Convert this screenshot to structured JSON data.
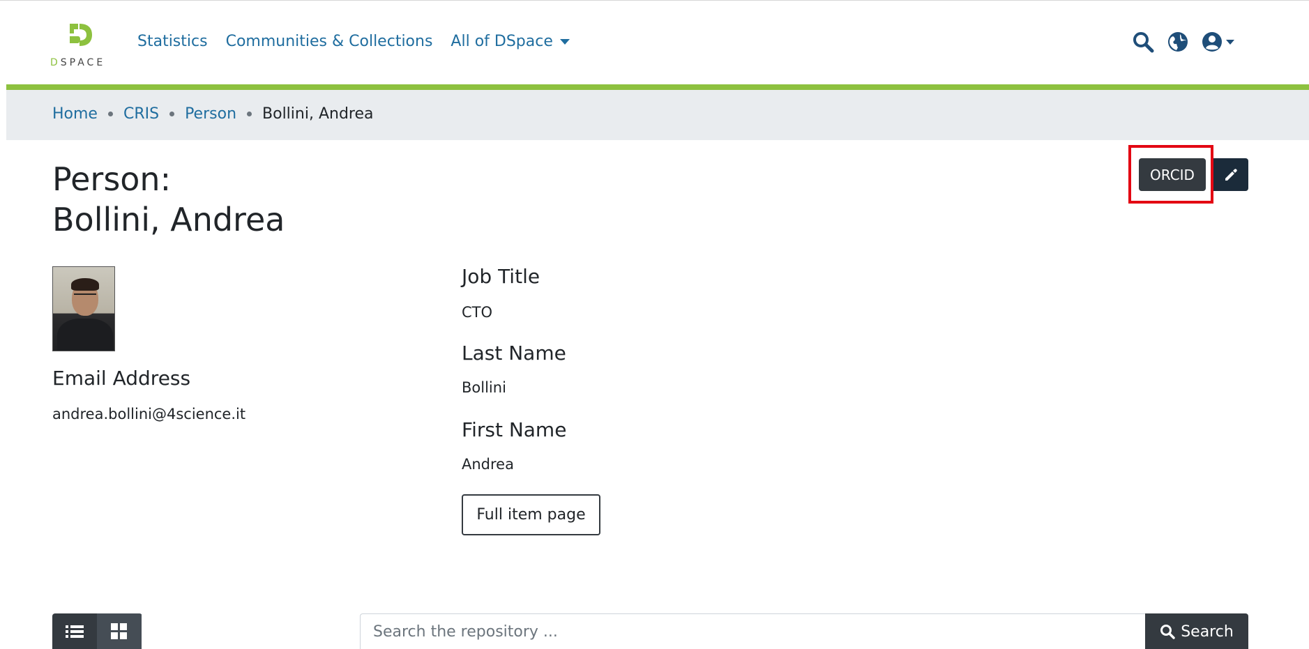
{
  "brand": {
    "logo_text": "DSPACE",
    "accent_color": "#8dc13f",
    "link_color": "#1f6d9f"
  },
  "nav": {
    "items": [
      {
        "label": "Statistics"
      },
      {
        "label": "Communities & Collections"
      },
      {
        "label": "All of DSpace"
      }
    ]
  },
  "header_icons": [
    "search-icon",
    "globe-icon",
    "user-circle-icon"
  ],
  "breadcrumb": {
    "items": [
      "Home",
      "CRIS",
      "Person"
    ],
    "current": "Bollini, Andrea"
  },
  "page": {
    "title_prefix": "Person:",
    "title_name": "Bollini, Andrea"
  },
  "actions": {
    "orcid_label": "ORCID",
    "edit_icon": "pencil-icon"
  },
  "left_fields": {
    "email_label": "Email Address",
    "email_value": "andrea.bollini@4science.it"
  },
  "right_fields": [
    {
      "label": "Job Title",
      "value": "CTO"
    },
    {
      "label": "Last Name",
      "value": "Bollini"
    },
    {
      "label": "First Name",
      "value": "Andrea"
    }
  ],
  "full_item_label": "Full item page",
  "search": {
    "placeholder": "Search the repository ...",
    "button_label": "Search"
  },
  "view_modes": [
    "list-view-icon",
    "grid-view-icon"
  ]
}
